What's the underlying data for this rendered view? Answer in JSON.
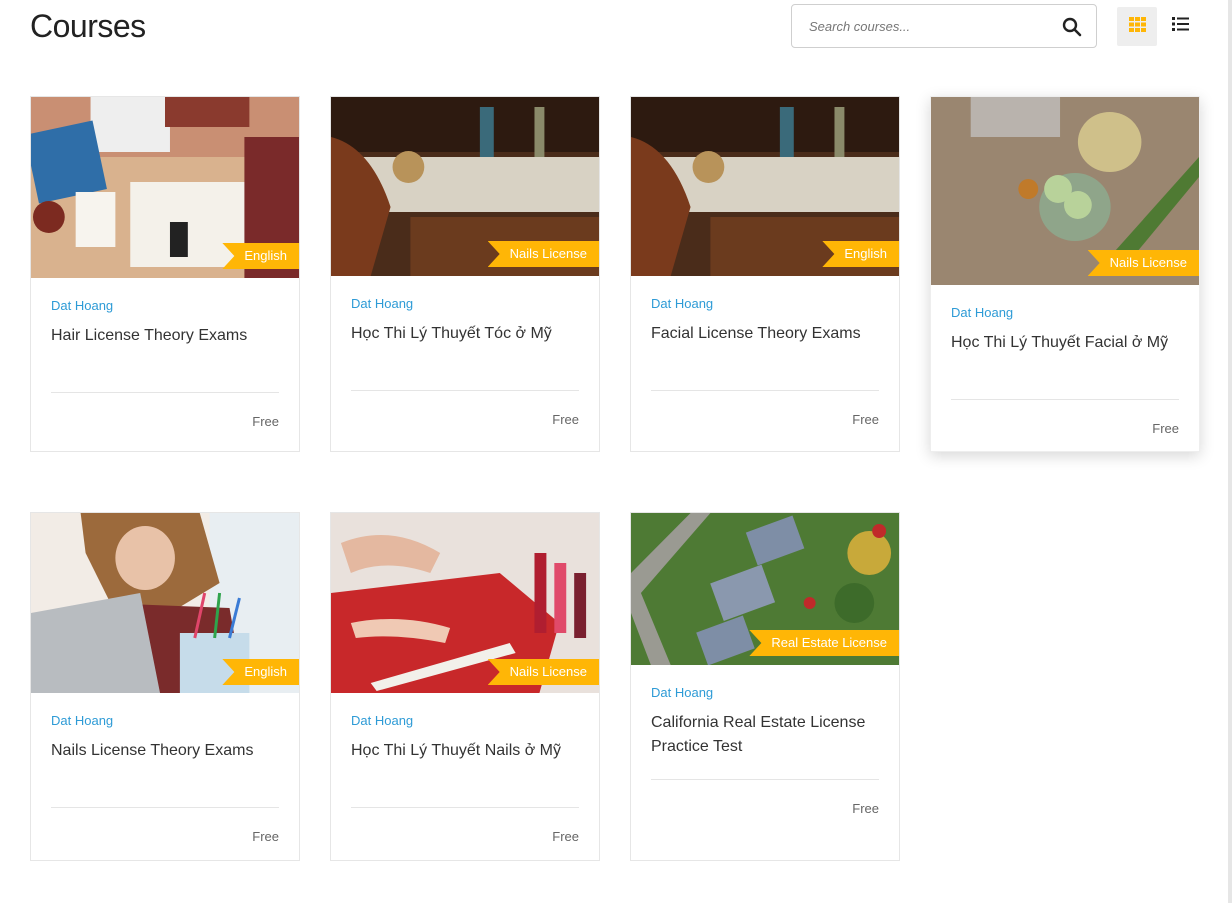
{
  "page": {
    "title": "Courses"
  },
  "search": {
    "placeholder": "Search courses...",
    "value": "",
    "icon": "search-icon"
  },
  "view_toggle": {
    "active": "grid",
    "grid_icon": "grid-icon",
    "list_icon": "list-icon",
    "accent": "#ffb606"
  },
  "colors": {
    "ribbon": "#ffb606",
    "author": "#2e9bd6"
  },
  "courses": [
    {
      "category": "English",
      "author": "Dat Hoang",
      "title": "Hair License Theory Exams",
      "price": "Free",
      "image": "desk-with-books-and-phone"
    },
    {
      "category": "Nails License",
      "author": "Dat Hoang",
      "title": "Học Thi Lý Thuyết Tóc ở Mỹ",
      "price": "Free",
      "image": "barbershop-chairs"
    },
    {
      "category": "English",
      "author": "Dat Hoang",
      "title": "Facial License Theory Exams",
      "price": "Free",
      "image": "barbershop-chairs"
    },
    {
      "category": "Nails License",
      "author": "Dat Hoang",
      "title": "Học Thi Lý Thuyết Facial ở Mỹ",
      "price": "Free",
      "image": "cucumber-and-aloe-spa"
    },
    {
      "category": "English",
      "author": "Dat Hoang",
      "title": "Nails License Theory Exams",
      "price": "Free",
      "image": "student-with-laptop"
    },
    {
      "category": "Nails License",
      "author": "Dat Hoang",
      "title": "Học Thi Lý Thuyết Nails ở Mỹ",
      "price": "Free",
      "image": "nail-polish-manicure"
    },
    {
      "category": "Real Estate License",
      "author": "Dat Hoang",
      "title": "California Real Estate License Practice Test",
      "price": "Free",
      "image": "aerial-houses"
    }
  ]
}
